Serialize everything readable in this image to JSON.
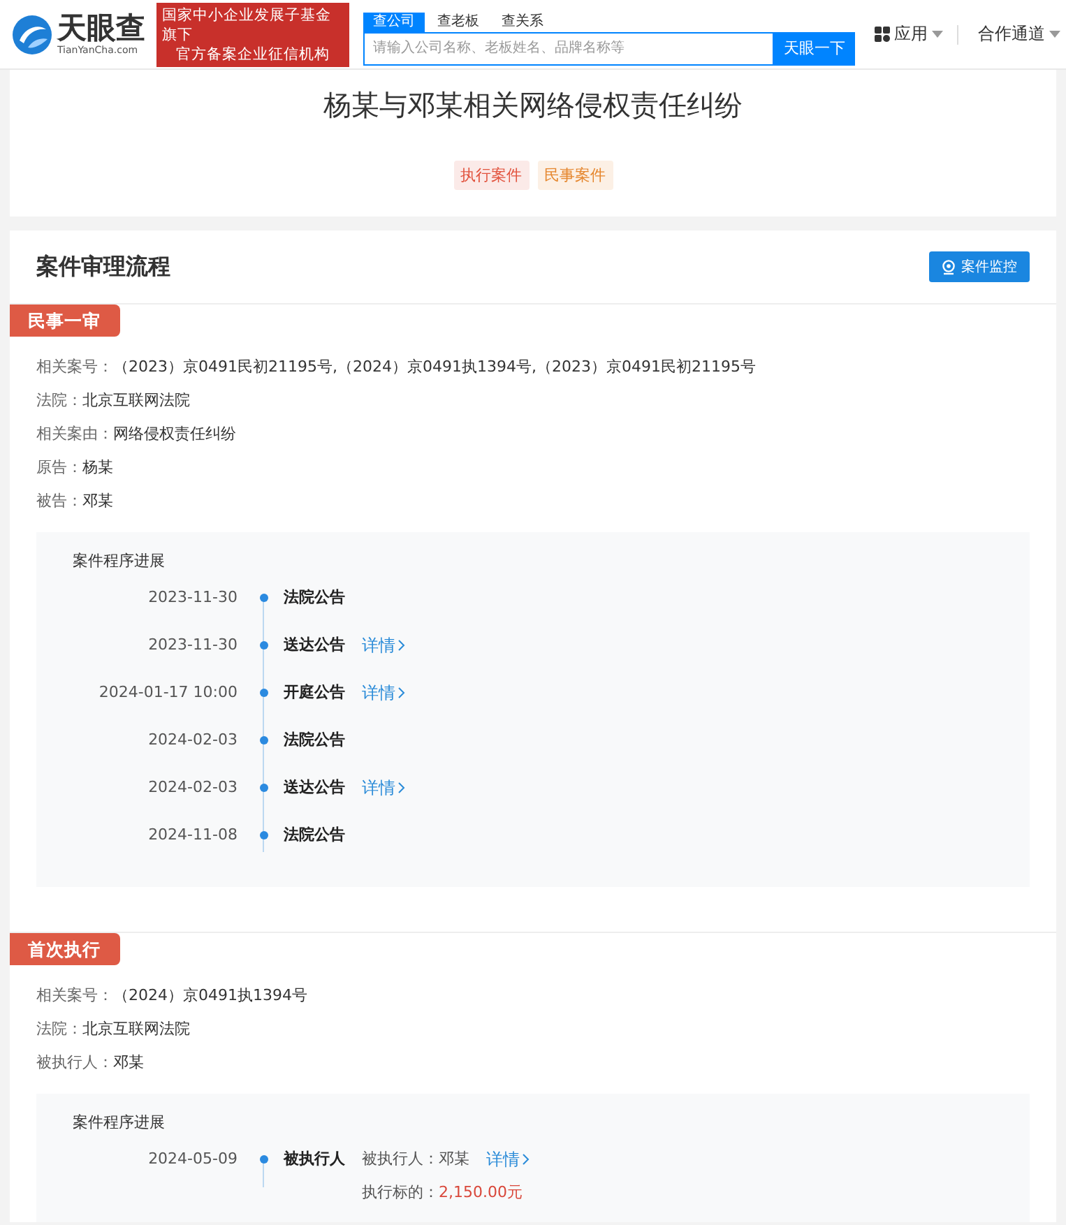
{
  "header": {
    "logo": {
      "name": "天眼查",
      "domain": "TianYanCha.com"
    },
    "slogan": [
      "国家中小企业发展子基金旗下",
      "官方备案企业征信机构"
    ],
    "search_tabs": [
      {
        "label": "查公司",
        "selected": true
      },
      {
        "label": "查老板",
        "selected": false
      },
      {
        "label": "查关系",
        "selected": false
      }
    ],
    "search": {
      "placeholder": "请输入公司名称、老板姓名、品牌名称等",
      "button": "天眼一下"
    },
    "nav": [
      {
        "label": "应用",
        "kind": "apps"
      },
      {
        "label": "合作通道",
        "kind": "plain"
      }
    ]
  },
  "case": {
    "title": "杨某与邓某相关网络侵权责任纠纷",
    "tags": [
      {
        "label": "执行案件",
        "color": "#e2533e"
      },
      {
        "label": "民事案件",
        "color": "#e5862d"
      }
    ]
  },
  "process": {
    "title": "案件审理流程",
    "monitor_button": "案件监控",
    "stages": [
      {
        "name": "民事一审",
        "fields": [
          {
            "label": "相关案号：",
            "value": "（2023）京0491民初21195号,（2024）京0491执1394号,（2023）京0491民初21195号"
          },
          {
            "label": "法院：",
            "value": "北京互联网法院"
          },
          {
            "label": "相关案由：",
            "value": "网络侵权责任纠纷"
          },
          {
            "label": "原告：",
            "value": "杨某"
          },
          {
            "label": "被告：",
            "value": "邓某"
          }
        ],
        "progress": {
          "title": "案件程序进展",
          "entries": [
            {
              "date": "2023-11-30",
              "event": "法院公告"
            },
            {
              "date": "2023-11-30",
              "event": "送达公告",
              "link": "详情"
            },
            {
              "date": "2024-01-17 10:00",
              "event": "开庭公告",
              "link": "详情"
            },
            {
              "date": "2024-02-03",
              "event": "法院公告"
            },
            {
              "date": "2024-02-03",
              "event": "送达公告",
              "link": "详情"
            },
            {
              "date": "2024-11-08",
              "event": "法院公告"
            }
          ]
        }
      },
      {
        "name": "首次执行",
        "fields": [
          {
            "label": "相关案号：",
            "value": "（2024）京0491执1394号"
          },
          {
            "label": "法院：",
            "value": "北京互联网法院"
          },
          {
            "label": "被执行人：",
            "value": "邓某"
          }
        ],
        "progress": {
          "title": "案件程序进展",
          "entries": [
            {
              "date": "2024-05-09",
              "event": "被执行人",
              "info": [
                {
                  "label": "被执行人：",
                  "value": "邓某",
                  "kind": "plain"
                },
                {
                  "label": "执行标的：",
                  "value": "2,150.00元",
                  "kind": "amount"
                }
              ],
              "link": "详情"
            }
          ]
        }
      }
    ]
  }
}
